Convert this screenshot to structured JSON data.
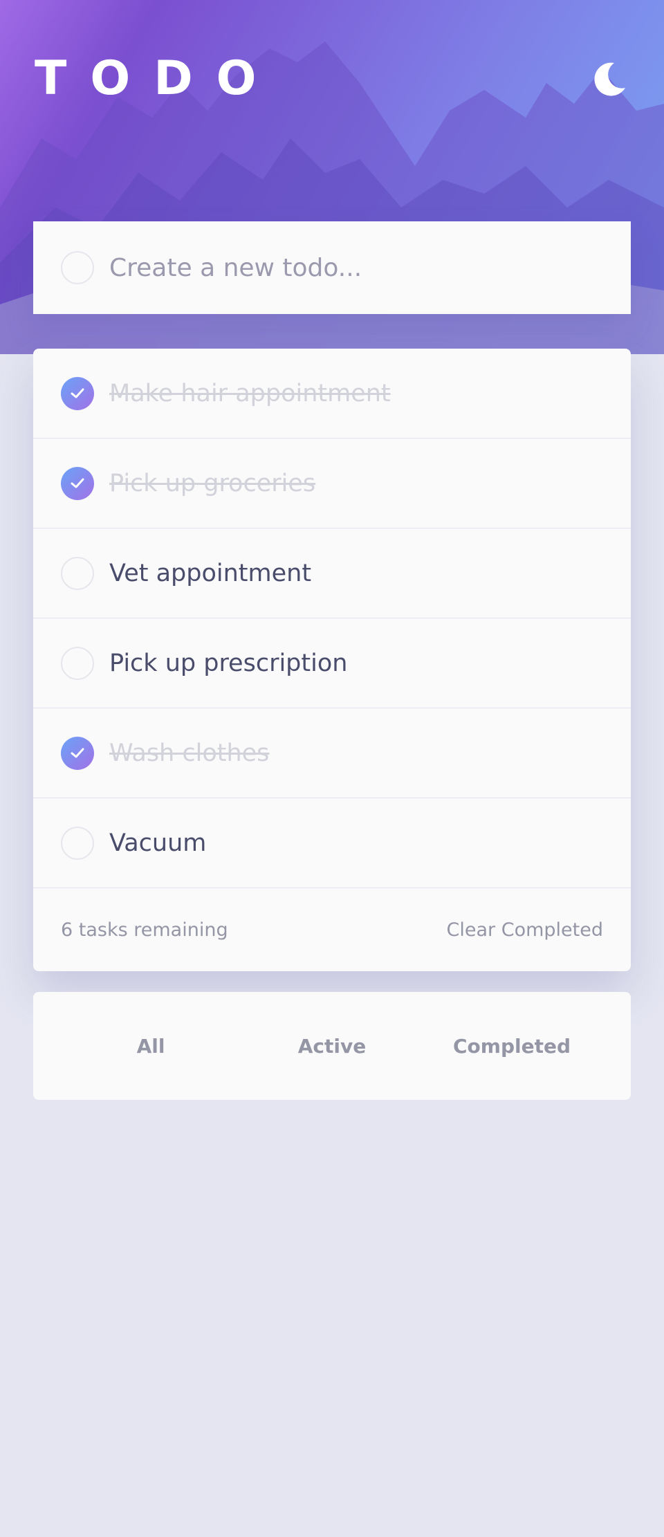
{
  "app": {
    "title": "TODO",
    "theme_icon": "moon-icon",
    "accent_gradient": [
      "#6aa3f7",
      "#a271e6"
    ]
  },
  "new_todo": {
    "placeholder": "Create a new todo..."
  },
  "todos": [
    {
      "text": "Make hair appointment",
      "completed": true
    },
    {
      "text": "Pick up groceries",
      "completed": true
    },
    {
      "text": "Vet appointment",
      "completed": false
    },
    {
      "text": "Pick up prescription",
      "completed": false
    },
    {
      "text": "Wash clothes",
      "completed": true
    },
    {
      "text": "Vacuum",
      "completed": false
    }
  ],
  "footer": {
    "remaining": "6 tasks remaining",
    "clear_label": "Clear Completed"
  },
  "filters": [
    {
      "label": "All"
    },
    {
      "label": "Active"
    },
    {
      "label": "Completed"
    }
  ]
}
